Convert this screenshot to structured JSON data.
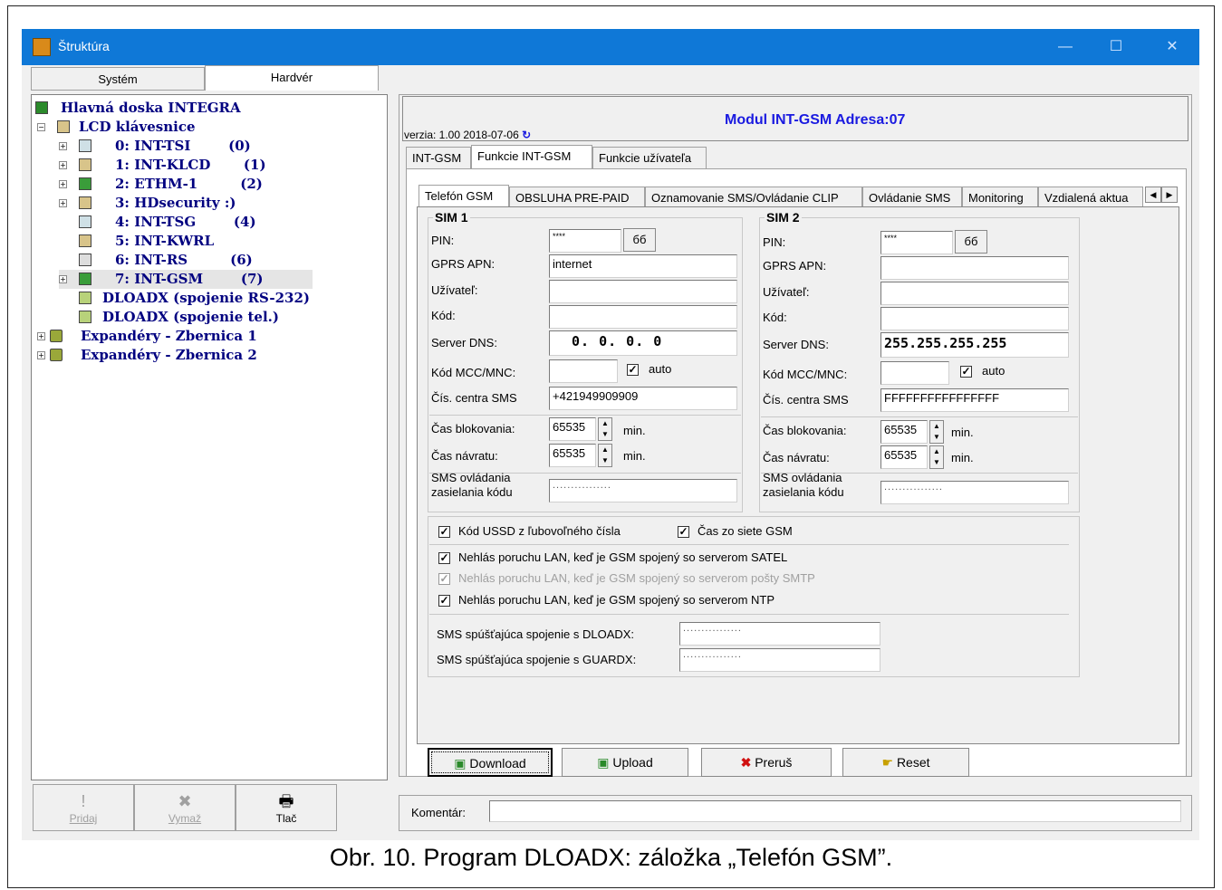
{
  "window": {
    "title": "Štruktúra"
  },
  "left_tabs": [
    "Systém",
    "Hardvér"
  ],
  "tree": [
    {
      "text": "Hlavná doska INTEGRA",
      "icon": "board-icon"
    },
    {
      "text": "LCD klávesnice",
      "icon": "keypad-icon"
    },
    {
      "text": "0: INT-TSI        (0)",
      "icon": "touchscreen-icon"
    },
    {
      "text": "1: INT-KLCD       (1)",
      "icon": "keypad-icon"
    },
    {
      "text": "2: ETHM-1         (2)",
      "icon": "network-icon"
    },
    {
      "text": "3: HDsecurity :)",
      "icon": "keypad-icon"
    },
    {
      "text": "4: INT-TSG        (4)",
      "icon": "touchscreen-icon"
    },
    {
      "text": "5: INT-KWRL",
      "icon": "keypad-icon"
    },
    {
      "text": "6: INT-RS         (6)",
      "icon": "serial-icon"
    },
    {
      "text": "7: INT-GSM        (7)",
      "icon": "network-icon"
    },
    {
      "text": "DLOADX (spojenie RS-232)",
      "icon": "computer-icon"
    },
    {
      "text": "DLOADX (spojenie tel.)",
      "icon": "computer-icon"
    },
    {
      "text": "Expandéry - Zbernica 1",
      "icon": "expander-icon"
    },
    {
      "text": "Expandéry - Zbernica 2",
      "icon": "expander-icon"
    }
  ],
  "bottom_toolbar": {
    "add": "Pridaj",
    "delete": "Vymaž",
    "print": "Tlač"
  },
  "module": {
    "version": "verzia: 1.00 2018-07-06",
    "title": "Modul INT-GSM Adresa:07"
  },
  "module_tabs": [
    "INT-GSM",
    "Funkcie INT-GSM",
    "Funkcie užívateľa"
  ],
  "sub_tabs": [
    "Telefón GSM",
    "OBSLUHA PRE-PAID",
    "Oznamovanie SMS/Ovládanie CLIP",
    "Ovládanie SMS",
    "Monitoring",
    "Vzdialená aktua"
  ],
  "sim1": {
    "title": "SIM 1",
    "pin_label": "PIN:",
    "pin": "****",
    "show_label": "бб",
    "apn_label": "GPRS APN:",
    "apn": "internet",
    "user_label": "Užívateľ:",
    "user": "",
    "code_label": "Kód:",
    "code": "",
    "dns_label": "Server DNS:",
    "dns": "0.  0.  0.  0",
    "mcc_label": "Kód MCC/MNC:",
    "mcc": "",
    "auto_label": "auto",
    "auto": true,
    "smsc_label": "Čís. centra SMS",
    "smsc": "+421949909909",
    "block_label": "Čas blokovania:",
    "block": "65535",
    "ret_label": "Čas návratu:",
    "ret": "65535",
    "unit": "min.",
    "smscode_label1": "SMS ovládania",
    "smscode_label2": "zasielania kódu",
    "smscode": "................"
  },
  "sim2": {
    "title": "SIM 2",
    "pin_label": "PIN:",
    "pin": "****",
    "show_label": "бб",
    "apn_label": "GPRS APN:",
    "apn": "",
    "user_label": "Užívateľ:",
    "user": "",
    "code_label": "Kód:",
    "code": "",
    "dns_label": "Server DNS:",
    "dns": "255.255.255.255",
    "mcc_label": "Kód MCC/MNC:",
    "mcc": "",
    "auto_label": "auto",
    "auto": true,
    "smsc_label": "Čís. centra SMS",
    "smsc": "FFFFFFFFFFFFFFFF",
    "block_label": "Čas blokovania:",
    "block": "65535",
    "ret_label": "Čas návratu:",
    "ret": "65535",
    "unit": "min.",
    "smscode_label1": "SMS ovládania",
    "smscode_label2": "zasielania kódu",
    "smscode": "................"
  },
  "options": {
    "ussd": "Kód USSD z ľubovoľného čísla",
    "gsm_time": "Čas zo siete GSM",
    "satel": "Nehlás poruchu LAN, keď je GSM spojený so serverom SATEL",
    "smtp": "Nehlás poruchu LAN, keď je GSM spojený so serverom pošty SMTP",
    "ntp": "Nehlás poruchu LAN, keď je GSM spojený so serverom NTP",
    "dloadx_label": "SMS spúšťajúca spojenie s DLOADX:",
    "dloadx": "................",
    "guardx_label": "SMS spúšťajúca spojenie s GUARDX:",
    "guardx": "................"
  },
  "actions": {
    "download": "Download",
    "upload": "Upload",
    "abort": "Preruš",
    "reset": "Reset"
  },
  "comment": {
    "label": "Komentár:",
    "value": ""
  },
  "caption": "Obr. 10. Program DLOADX: záložka „Telefón GSM”."
}
